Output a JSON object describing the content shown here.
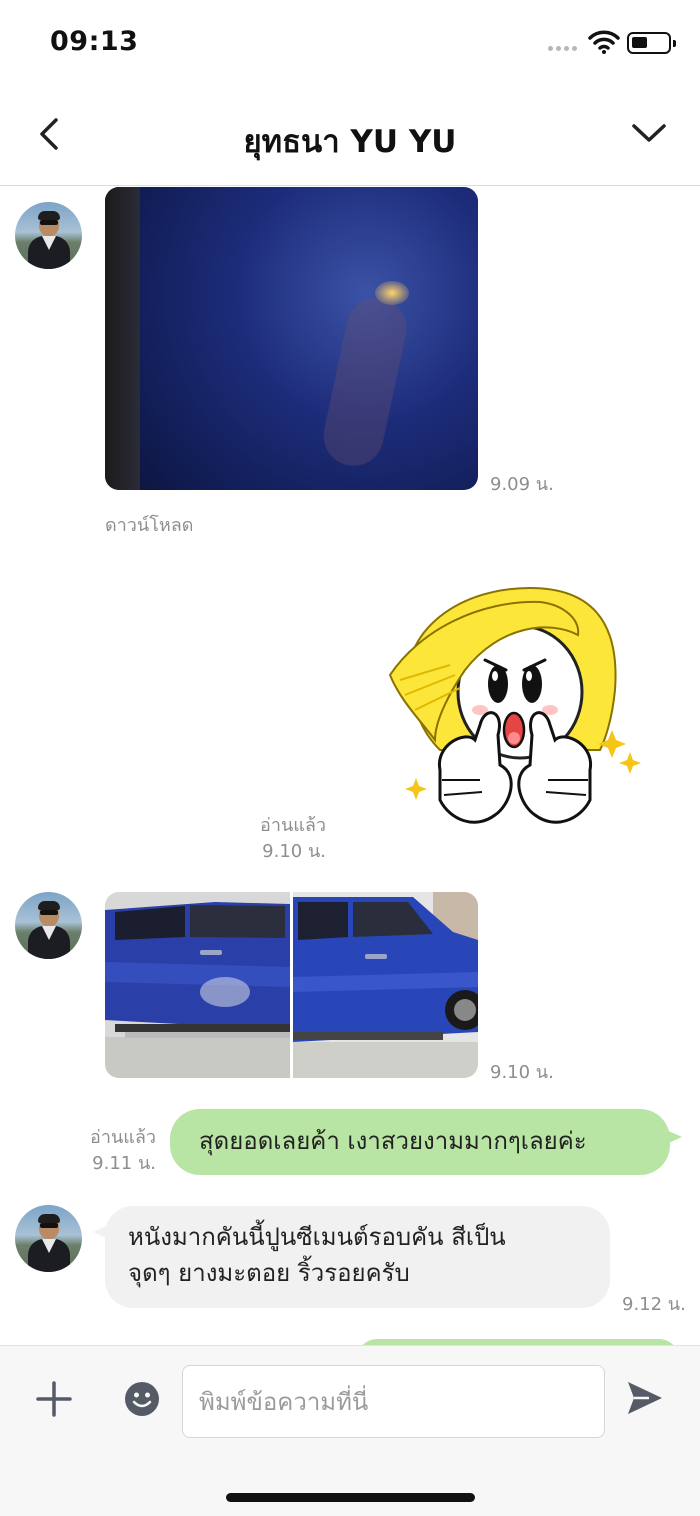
{
  "status_bar": {
    "time": "09:13"
  },
  "header": {
    "title": "ยุทธนา YU YU",
    "back_icon": "chevron-left-icon",
    "menu_icon": "chevron-down-icon"
  },
  "messages": [
    {
      "type": "image",
      "from": "contact",
      "time": "9.09 น.",
      "download_label": "ดาวน์โหลด"
    },
    {
      "type": "sticker",
      "from": "me",
      "read_label": "อ่านแล้ว",
      "time": "9.10 น."
    },
    {
      "type": "image",
      "from": "contact",
      "time": "9.10 น."
    },
    {
      "type": "text",
      "from": "me",
      "text": "สุดยอดเลยค้า เงาสวยงามมากๆเลยค่ะ",
      "read_label": "อ่านแล้ว",
      "time": "9.11 น."
    },
    {
      "type": "text",
      "from": "contact",
      "text_line1": "หนังมากคันนี้ปูนซีเมนต์รอบคัน สีเป็น",
      "text_line2": "จุดๆ ยางมะตอย ริ้วรอยครับ",
      "time": "9.12 น."
    }
  ],
  "input_bar": {
    "placeholder": "พิมพ์ข้อความที่นี่",
    "plus_icon": "plus-icon",
    "emoji_icon": "emoji-icon",
    "send_icon": "send-icon"
  },
  "colors": {
    "outgoing_bubble": "#b8e4a4",
    "incoming_bubble": "#f1f1f1",
    "meta_text": "#8e8e8e"
  }
}
